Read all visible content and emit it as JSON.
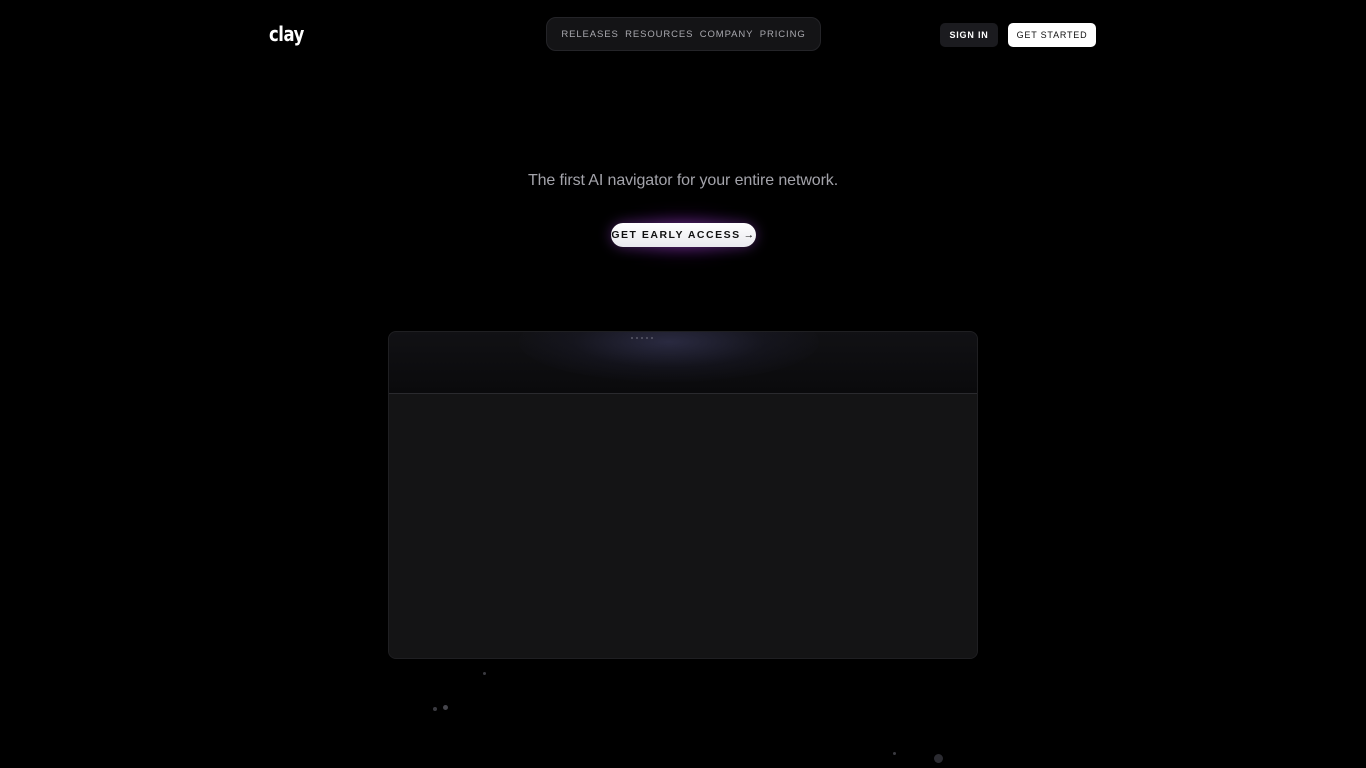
{
  "brand": {
    "logo_text": "clay"
  },
  "nav": {
    "items": [
      {
        "label": "RELEASES"
      },
      {
        "label": "RESOURCES"
      },
      {
        "label": "COMPANY"
      },
      {
        "label": "PRICING"
      }
    ]
  },
  "auth": {
    "sign_in_label": "SIGN IN",
    "get_started_label": "GET STARTED"
  },
  "hero": {
    "tagline": "The first AI navigator for your entire network.",
    "cta_label": "GET EARLY ACCESS",
    "cta_arrow": "→"
  },
  "colors": {
    "background": "#000000",
    "tagline": "#a3a3aa",
    "nav_text": "#a8a8ae",
    "cta_glow": "#9628be",
    "window_bg": "#141415"
  },
  "icons": {
    "cta_arrow_icon": "arrow-right-icon",
    "window_drag_handle": "drag-dots-icon"
  }
}
